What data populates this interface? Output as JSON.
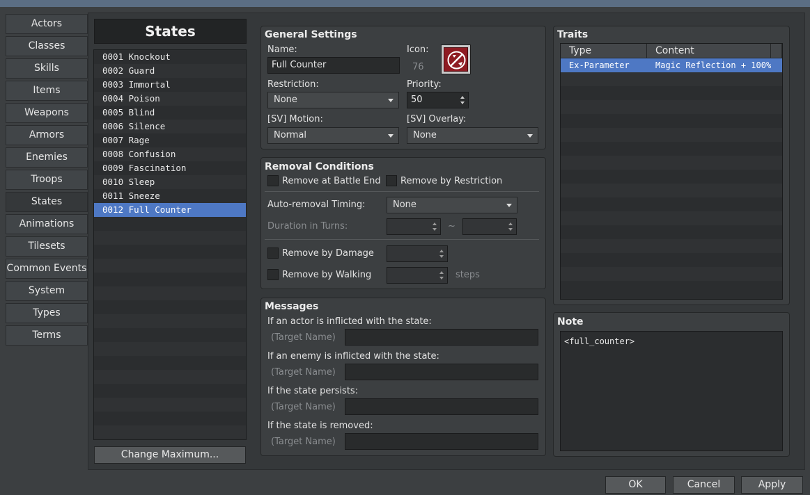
{
  "categories": [
    "Actors",
    "Classes",
    "Skills",
    "Items",
    "Weapons",
    "Armors",
    "Enemies",
    "Troops",
    "States",
    "Animations",
    "Tilesets",
    "Common Events",
    "System",
    "Types",
    "Terms"
  ],
  "active_category": "States",
  "list": {
    "title": "States",
    "items": [
      "0001 Knockout",
      "0002 Guard",
      "0003 Immortal",
      "0004 Poison",
      "0005 Blind",
      "0006 Silence",
      "0007 Rage",
      "0008 Confusion",
      "0009 Fascination",
      "0010 Sleep",
      "0011 Sneeze",
      "0012 Full Counter"
    ],
    "selected_index": 11,
    "change_max_label": "Change Maximum..."
  },
  "general": {
    "title": "General Settings",
    "name_label": "Name:",
    "name_value": "Full Counter",
    "icon_label": "Icon:",
    "icon_index": "76",
    "icon_name": "counter-icon",
    "restriction_label": "Restriction:",
    "restriction_value": "None",
    "priority_label": "Priority:",
    "priority_value": "50",
    "motion_label": "[SV] Motion:",
    "motion_value": "Normal",
    "overlay_label": "[SV] Overlay:",
    "overlay_value": "None"
  },
  "removal": {
    "title": "Removal Conditions",
    "battle_end_label": "Remove at Battle End",
    "by_restriction_label": "Remove by Restriction",
    "auto_timing_label": "Auto-removal Timing:",
    "auto_timing_value": "None",
    "duration_label": "Duration in Turns:",
    "tilde": "~",
    "by_damage_label": "Remove by Damage",
    "by_walking_label": "Remove by Walking",
    "steps_label": "steps"
  },
  "messages": {
    "title": "Messages",
    "target_placeholder": "(Target Name)",
    "rows": [
      {
        "label": "If an actor is inflicted with the state:",
        "value": ""
      },
      {
        "label": "If an enemy is inflicted with the state:",
        "value": ""
      },
      {
        "label": "If the state persists:",
        "value": ""
      },
      {
        "label": "If the state is removed:",
        "value": ""
      }
    ]
  },
  "traits": {
    "title": "Traits",
    "col_type": "Type",
    "col_content": "Content",
    "rows": [
      {
        "type": "Ex-Parameter",
        "content": "Magic Reflection + 100%"
      }
    ]
  },
  "note": {
    "title": "Note",
    "text": "<full_counter>"
  },
  "footer": {
    "ok": "OK",
    "cancel": "Cancel",
    "apply": "Apply"
  },
  "colors": {
    "selection": "#4e78c4",
    "icon_bg": "#8e1b22"
  }
}
